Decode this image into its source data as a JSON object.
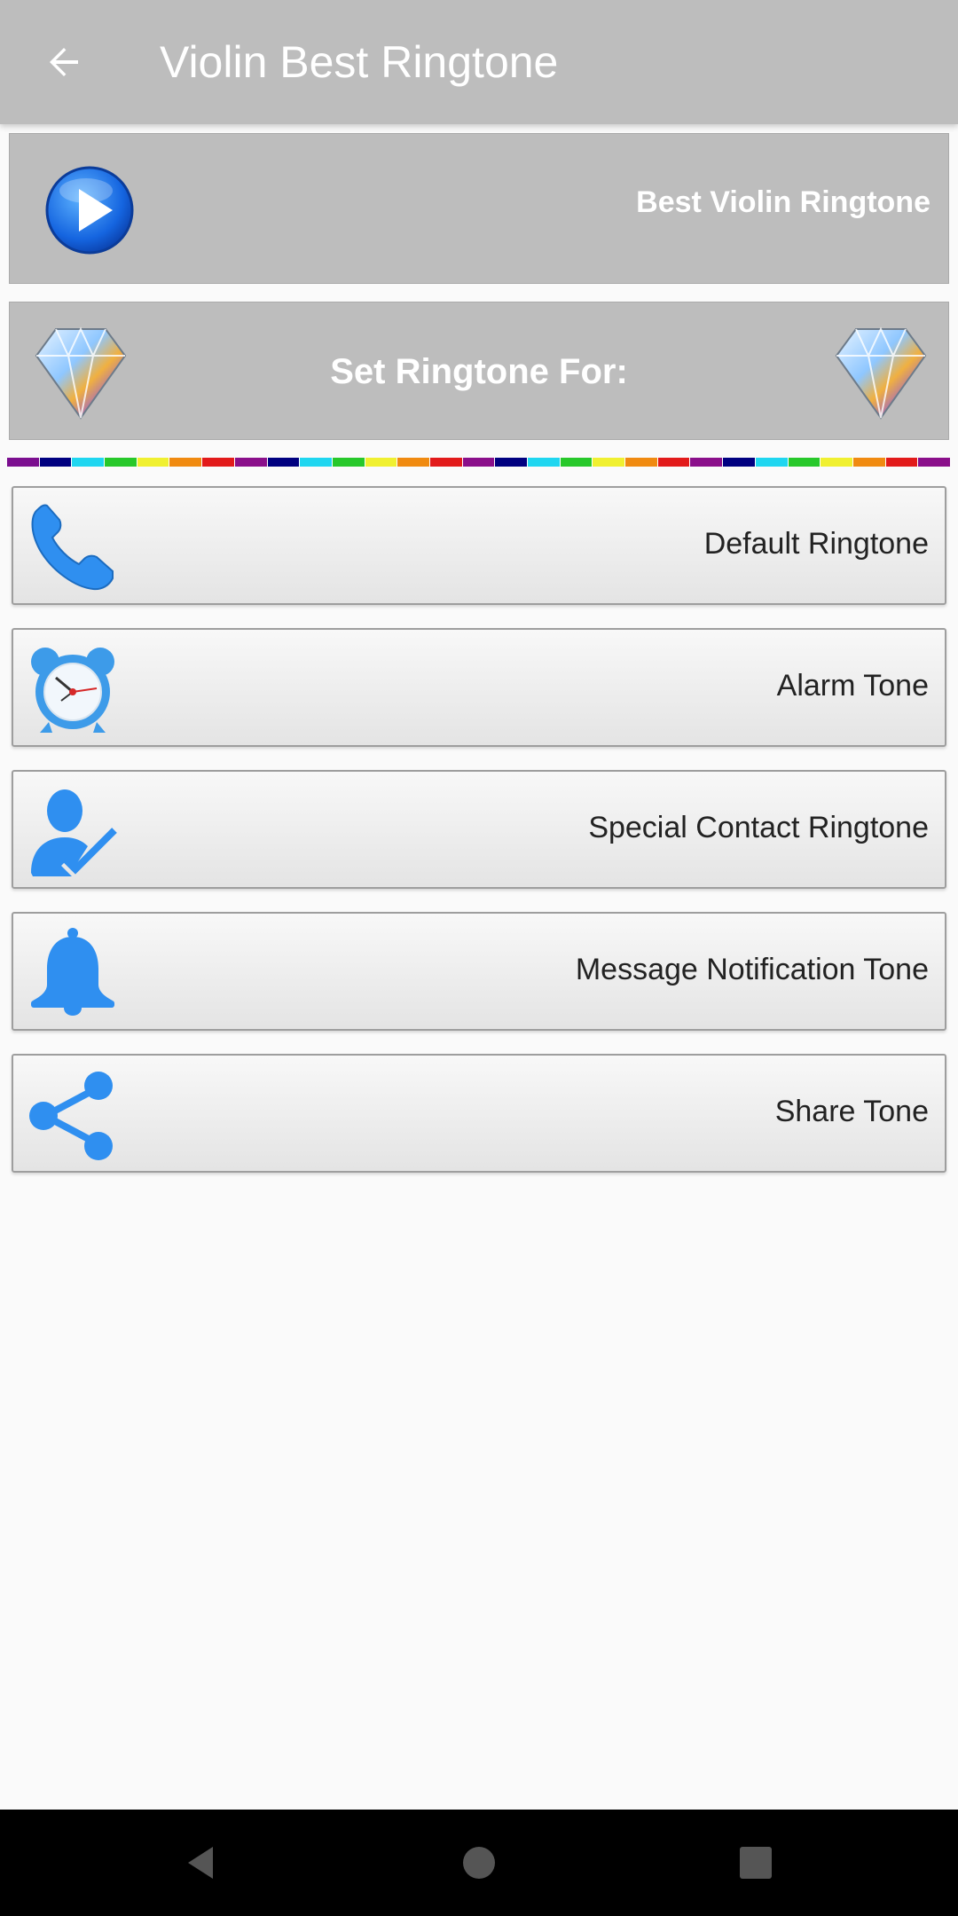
{
  "appbar": {
    "title": "Violin Best Ringtone",
    "back_icon": "arrow-back-icon"
  },
  "player": {
    "title": "Best Violin Ringtone",
    "icon": "play-icon"
  },
  "set_for": {
    "title": "Set Ringtone For:",
    "icon": "diamond-icon"
  },
  "stripe_colors": [
    "#7b0e8f",
    "#000080",
    "#1fd6f0",
    "#27c82a",
    "#f0f030",
    "#f08a10",
    "#e21a1a",
    "#8a0f8a",
    "#000080",
    "#1fd6f0",
    "#27c82a",
    "#f0f030",
    "#f08a10",
    "#e21a1a",
    "#8a0f8a",
    "#000080",
    "#1fd6f0",
    "#27c82a",
    "#f0f030",
    "#f08a10",
    "#e21a1a",
    "#8a0f8a",
    "#000080",
    "#1fd6f0",
    "#27c82a",
    "#f0f030",
    "#f08a10",
    "#e21a1a",
    "#8a0f8a"
  ],
  "options": [
    {
      "label": "Default Ringtone",
      "icon": "phone-icon"
    },
    {
      "label": "Alarm Tone",
      "icon": "alarm-clock-icon"
    },
    {
      "label": "Special Contact Ringtone",
      "icon": "contact-check-icon"
    },
    {
      "label": "Message Notification Tone",
      "icon": "bell-icon"
    },
    {
      "label": "Share Tone",
      "icon": "share-icon"
    }
  ],
  "navbar": {
    "back": "nav-back-icon",
    "home": "nav-home-icon",
    "recents": "nav-recents-icon"
  },
  "colors": {
    "appbar": "#bdbdbd",
    "icon_blue": "#3d8ee8",
    "background": "#fafafa"
  }
}
